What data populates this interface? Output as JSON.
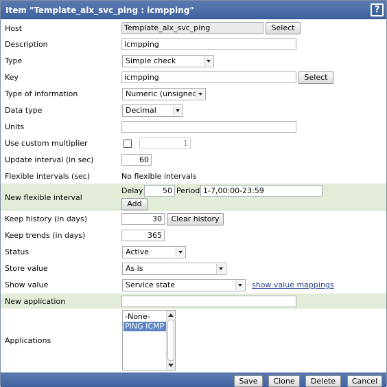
{
  "window": {
    "title": "Item \"Template_alx_svc_ping : icmpping\"",
    "help_label": "?"
  },
  "host": {
    "label": "Host",
    "value": "Template_alx_svc_ping",
    "select_label": "Select"
  },
  "description": {
    "label": "Description",
    "value": "icmpping"
  },
  "type": {
    "label": "Type",
    "value": "Simple check"
  },
  "key": {
    "label": "Key",
    "value": "icmpping",
    "select_label": "Select"
  },
  "type_of_information": {
    "label": "Type of information",
    "value": "Numeric (unsigned)"
  },
  "data_type": {
    "label": "Data type",
    "value": "Decimal"
  },
  "units": {
    "label": "Units",
    "value": ""
  },
  "custom_multiplier": {
    "label": "Use custom multiplier",
    "checked": false,
    "value": "1"
  },
  "update_interval": {
    "label": "Update interval (in sec)",
    "value": "60"
  },
  "flexible_intervals": {
    "label": "Flexible intervals (sec)",
    "value": "No flexible intervals"
  },
  "new_flexible_interval": {
    "label": "New flexible interval",
    "delay_label": "Delay",
    "delay_value": "50",
    "period_label": "Period",
    "period_value": "1-7,00:00-23:59",
    "add_label": "Add"
  },
  "keep_history": {
    "label": "Keep history (in days)",
    "value": "30",
    "clear_label": "Clear history"
  },
  "keep_trends": {
    "label": "Keep trends (in days)",
    "value": "365"
  },
  "status": {
    "label": "Status",
    "value": "Active"
  },
  "store_value": {
    "label": "Store value",
    "value": "As is"
  },
  "show_value": {
    "label": "Show value",
    "value": "Service state",
    "mappings_link": "show value mappings"
  },
  "new_application": {
    "label": "New application",
    "value": ""
  },
  "applications": {
    "label": "Applications",
    "options": [
      "-None-",
      "PING ICMP"
    ],
    "selected": "PING ICMP"
  },
  "footer": {
    "save": "Save",
    "clone": "Clone",
    "delete": "Delete",
    "cancel": "Cancel"
  }
}
